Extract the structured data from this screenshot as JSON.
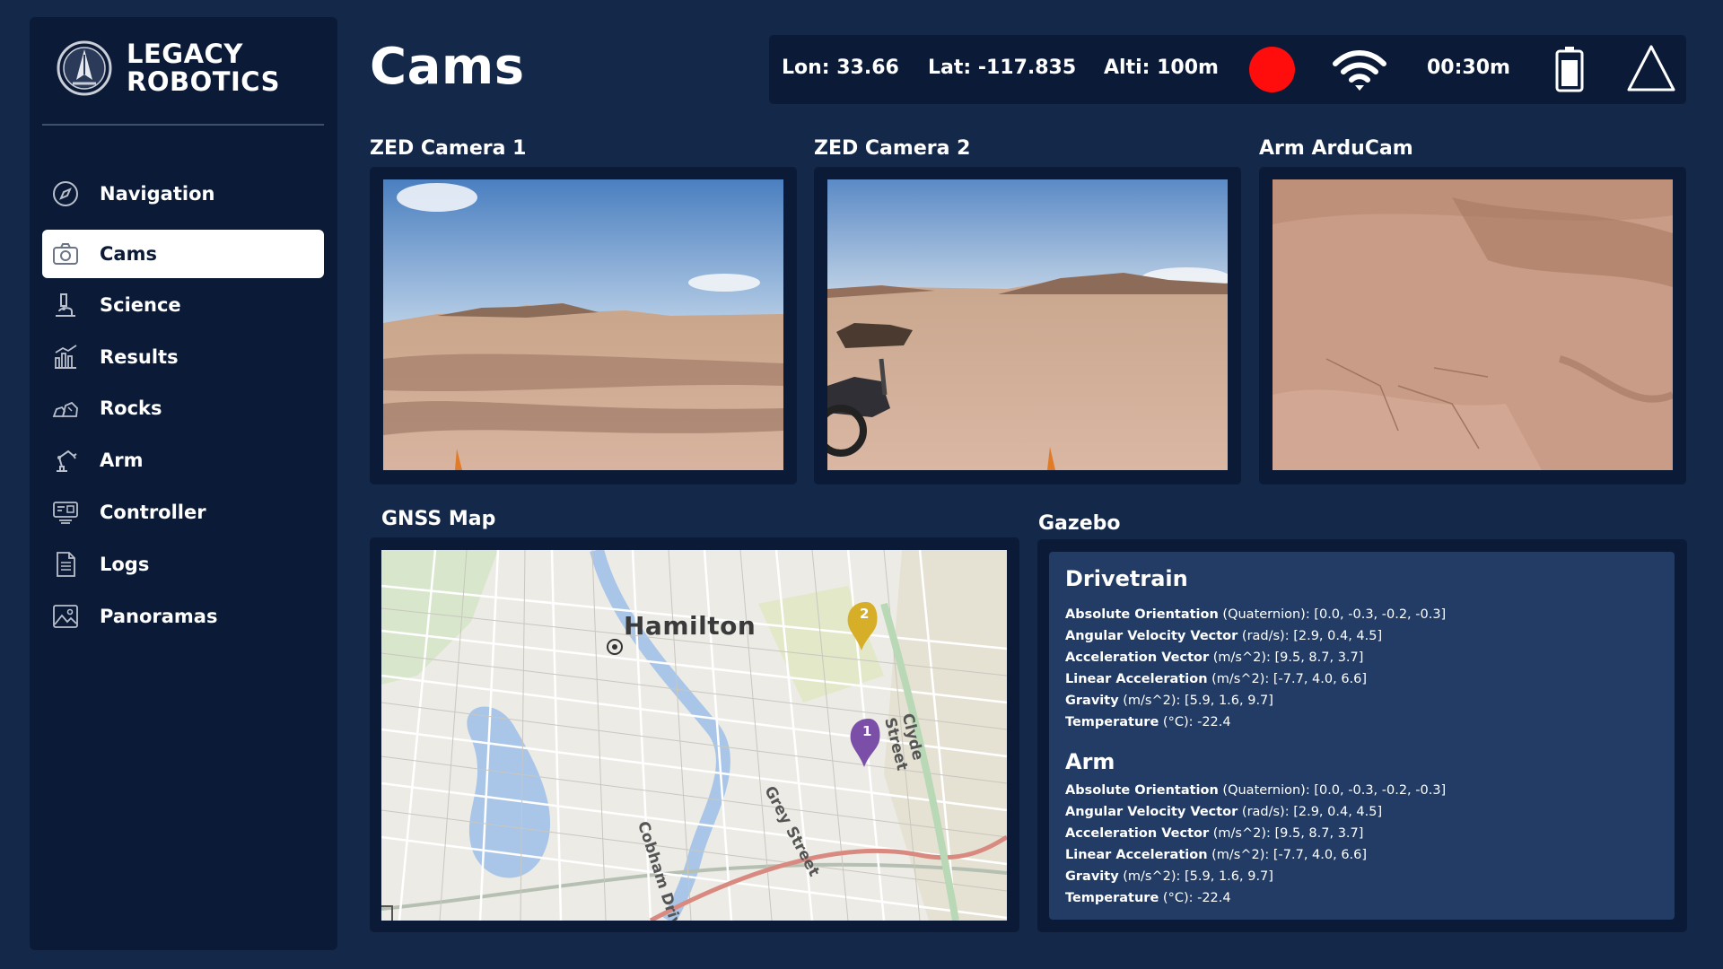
{
  "brand": {
    "line1": "LEGACY",
    "line2": "ROBOTICS"
  },
  "sidebar": {
    "items": [
      {
        "label": "Navigation",
        "icon": "compass-icon",
        "active": false
      },
      {
        "label": "Cams",
        "icon": "camera-icon",
        "active": true
      },
      {
        "label": "Science",
        "icon": "microscope-icon",
        "active": false
      },
      {
        "label": "Results",
        "icon": "bar-chart-icon",
        "active": false
      },
      {
        "label": "Rocks",
        "icon": "rocks-icon",
        "active": false
      },
      {
        "label": "Arm",
        "icon": "robot-arm-icon",
        "active": false
      },
      {
        "label": "Controller",
        "icon": "controller-icon",
        "active": false
      },
      {
        "label": "Logs",
        "icon": "document-icon",
        "active": false
      },
      {
        "label": "Panoramas",
        "icon": "image-icon",
        "active": false
      }
    ]
  },
  "header": {
    "title": "Cams"
  },
  "status": {
    "lon": "Lon: 33.66",
    "lat": "Lat: -117.835",
    "alti": "Alti: 100m",
    "timer": "00:30m",
    "recording_color": "#ff0d0d"
  },
  "cameras": [
    {
      "label": "ZED Camera 1"
    },
    {
      "label": "ZED Camera 2"
    },
    {
      "label": "Arm ArduCam"
    }
  ],
  "map": {
    "label": "GNSS Map",
    "city": "Hamilton",
    "streets": [
      "Cobham Drive",
      "Grey Street",
      "Clyde Street"
    ],
    "markers": [
      "1",
      "2"
    ]
  },
  "gazebo": {
    "label": "Gazebo",
    "sections": [
      {
        "title": "Drivetrain",
        "rows": [
          {
            "name": "Absolute Orientation",
            "rest": " (Quaternion): [0.0, -0.3, -0.2, -0.3]"
          },
          {
            "name": "Angular Velocity Vector",
            "rest": " (rad/s): [2.9, 0.4, 4.5]"
          },
          {
            "name": "Acceleration Vector",
            "rest": " (m/s^2): [9.5, 8.7, 3.7]"
          },
          {
            "name": "Linear Acceleration",
            "rest": " (m/s^2): [-7.7, 4.0, 6.6]"
          },
          {
            "name": "Gravity",
            "rest": " (m/s^2): [5.9, 1.6, 9.7]"
          },
          {
            "name": "Temperature",
            "rest": " (°C): -22.4"
          }
        ]
      },
      {
        "title": "Arm",
        "rows": [
          {
            "name": "Absolute Orientation",
            "rest": " (Quaternion): [0.0, -0.3, -0.2, -0.3]"
          },
          {
            "name": "Angular Velocity Vector",
            "rest": " (rad/s): [2.9, 0.4, 4.5]"
          },
          {
            "name": "Acceleration Vector",
            "rest": " (m/s^2): [9.5, 8.7, 3.7]"
          },
          {
            "name": "Linear Acceleration",
            "rest": " (m/s^2): [-7.7, 4.0, 6.6]"
          },
          {
            "name": "Gravity",
            "rest": " (m/s^2): [5.9, 1.6, 9.7]"
          },
          {
            "name": "Temperature",
            "rest": " (°C): -22.4"
          }
        ]
      }
    ]
  }
}
